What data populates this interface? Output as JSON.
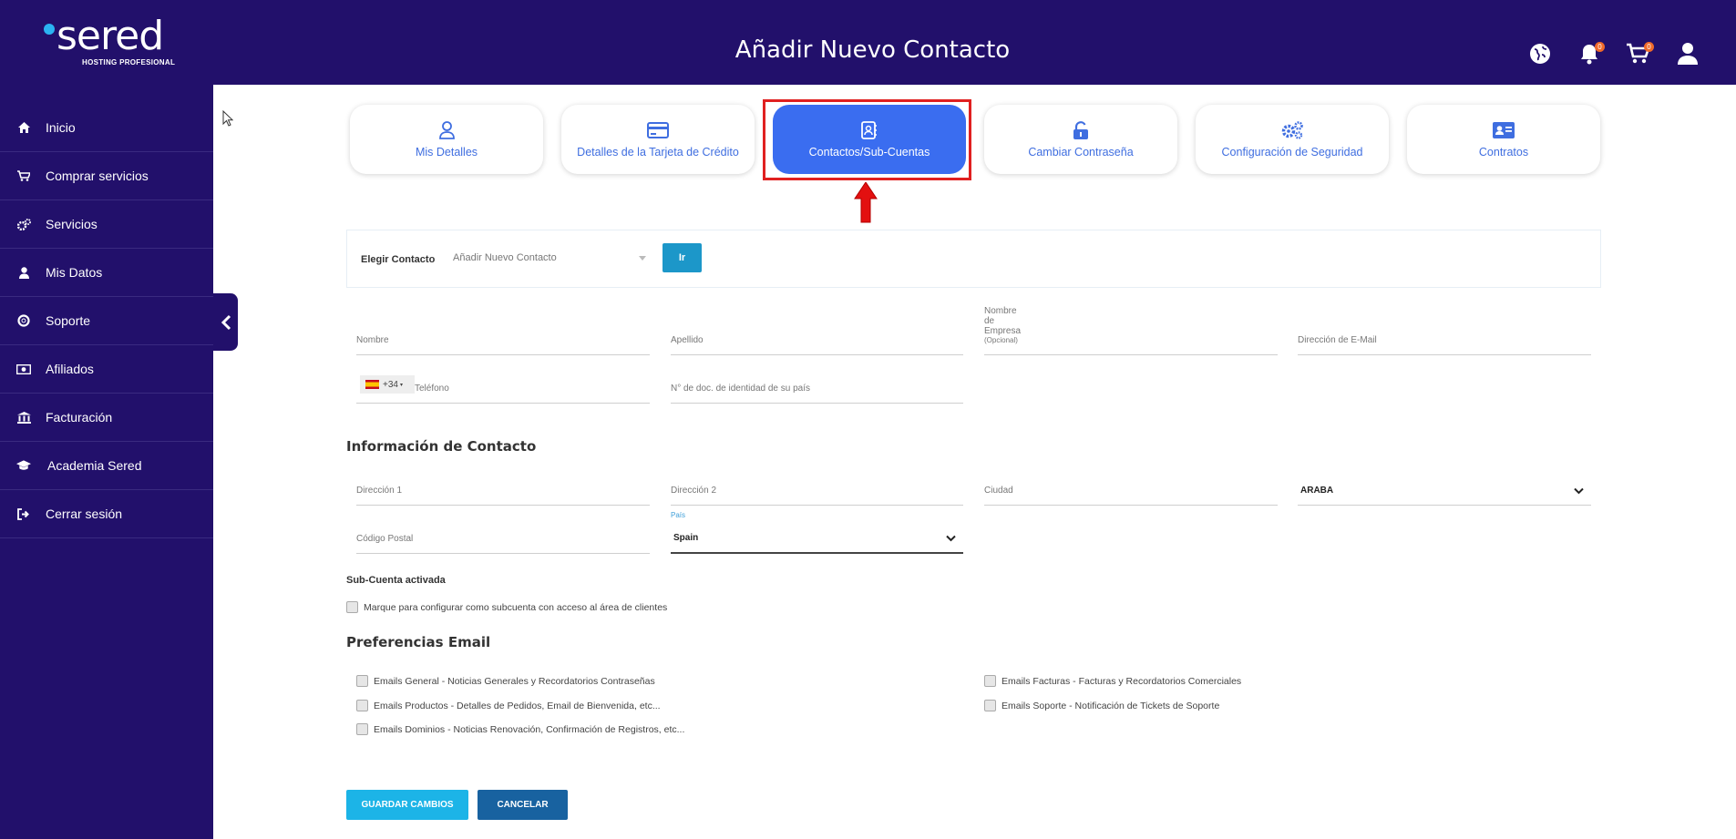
{
  "brand": {
    "name": "sered",
    "tagline": "HOSTING PROFESIONAL"
  },
  "header": {
    "title": "Añadir Nuevo Contacto",
    "notifications_count": "0",
    "cart_count": "0"
  },
  "sidebar": {
    "items": [
      {
        "label": "Inicio",
        "icon": "home-icon"
      },
      {
        "label": "Comprar servicios",
        "icon": "cart-icon"
      },
      {
        "label": "Servicios",
        "icon": "gears-icon"
      },
      {
        "label": "Mis Datos",
        "icon": "user-icon"
      },
      {
        "label": "Soporte",
        "icon": "lifebuoy-icon"
      },
      {
        "label": "Afiliados",
        "icon": "money-icon"
      },
      {
        "label": "Facturación",
        "icon": "bank-icon"
      },
      {
        "label": "Academia Sered",
        "icon": "graduation-cap-icon"
      },
      {
        "label": "Cerrar sesión",
        "icon": "logout-icon"
      }
    ]
  },
  "tabs": [
    {
      "label": "Mis Detalles",
      "icon": "user-outline-icon",
      "active": false
    },
    {
      "label": "Detalles de la Tarjeta de Crédito",
      "icon": "credit-card-icon",
      "active": false
    },
    {
      "label": "Contactos/Sub-Cuentas",
      "icon": "address-book-icon",
      "active": true
    },
    {
      "label": "Cambiar Contraseña",
      "icon": "unlock-icon",
      "active": false
    },
    {
      "label": "Configuración de Seguridad",
      "icon": "security-gears-icon",
      "active": false
    },
    {
      "label": "Contratos",
      "icon": "id-card-icon",
      "active": false
    }
  ],
  "chooser": {
    "label": "Elegir Contacto",
    "selected": "Añadir Nuevo Contacto",
    "go_label": "Ir"
  },
  "form": {
    "nombre": "Nombre",
    "apellido": "Apellido",
    "empresa": "Nombre de Empresa",
    "empresa_optional": "(Opcional)",
    "email": "Dirección de E-Mail",
    "phone_code": "+34",
    "telefono": "Teléfono",
    "doc_id": "N° de doc. de identidad de su país"
  },
  "contact_info": {
    "title": "Información de Contacto",
    "direccion1": "Dirección 1",
    "direccion2": "Dirección 2",
    "ciudad": "Ciudad",
    "region": "ARABA",
    "codigo_postal": "Código Postal",
    "pais_label": "País",
    "pais": "Spain"
  },
  "subaccount": {
    "title": "Sub-Cuenta activada",
    "checkbox_label": "Marque para configurar como subcuenta con acceso al área de clientes"
  },
  "email_prefs": {
    "title": "Preferencias Email",
    "general": "Emails General - Noticias Generales y Recordatorios Contraseñas",
    "productos": "Emails Productos - Detalles de Pedidos, Email de Bienvenida, etc...",
    "dominios": "Emails Dominios - Noticias Renovación, Confirmación de Registros, etc...",
    "facturas": "Emails Facturas - Facturas y Recordatorios Comerciales",
    "soporte": "Emails Soporte - Notificación de Tickets de Soporte"
  },
  "actions": {
    "save": "GUARDAR CAMBIOS",
    "cancel": "CANCELAR"
  },
  "colors": {
    "brand_dark": "#22106b",
    "accent_blue": "#3a6df0",
    "highlight_red": "#e02020",
    "save_button": "#1cb4e7",
    "cancel_button": "#1862a0"
  }
}
